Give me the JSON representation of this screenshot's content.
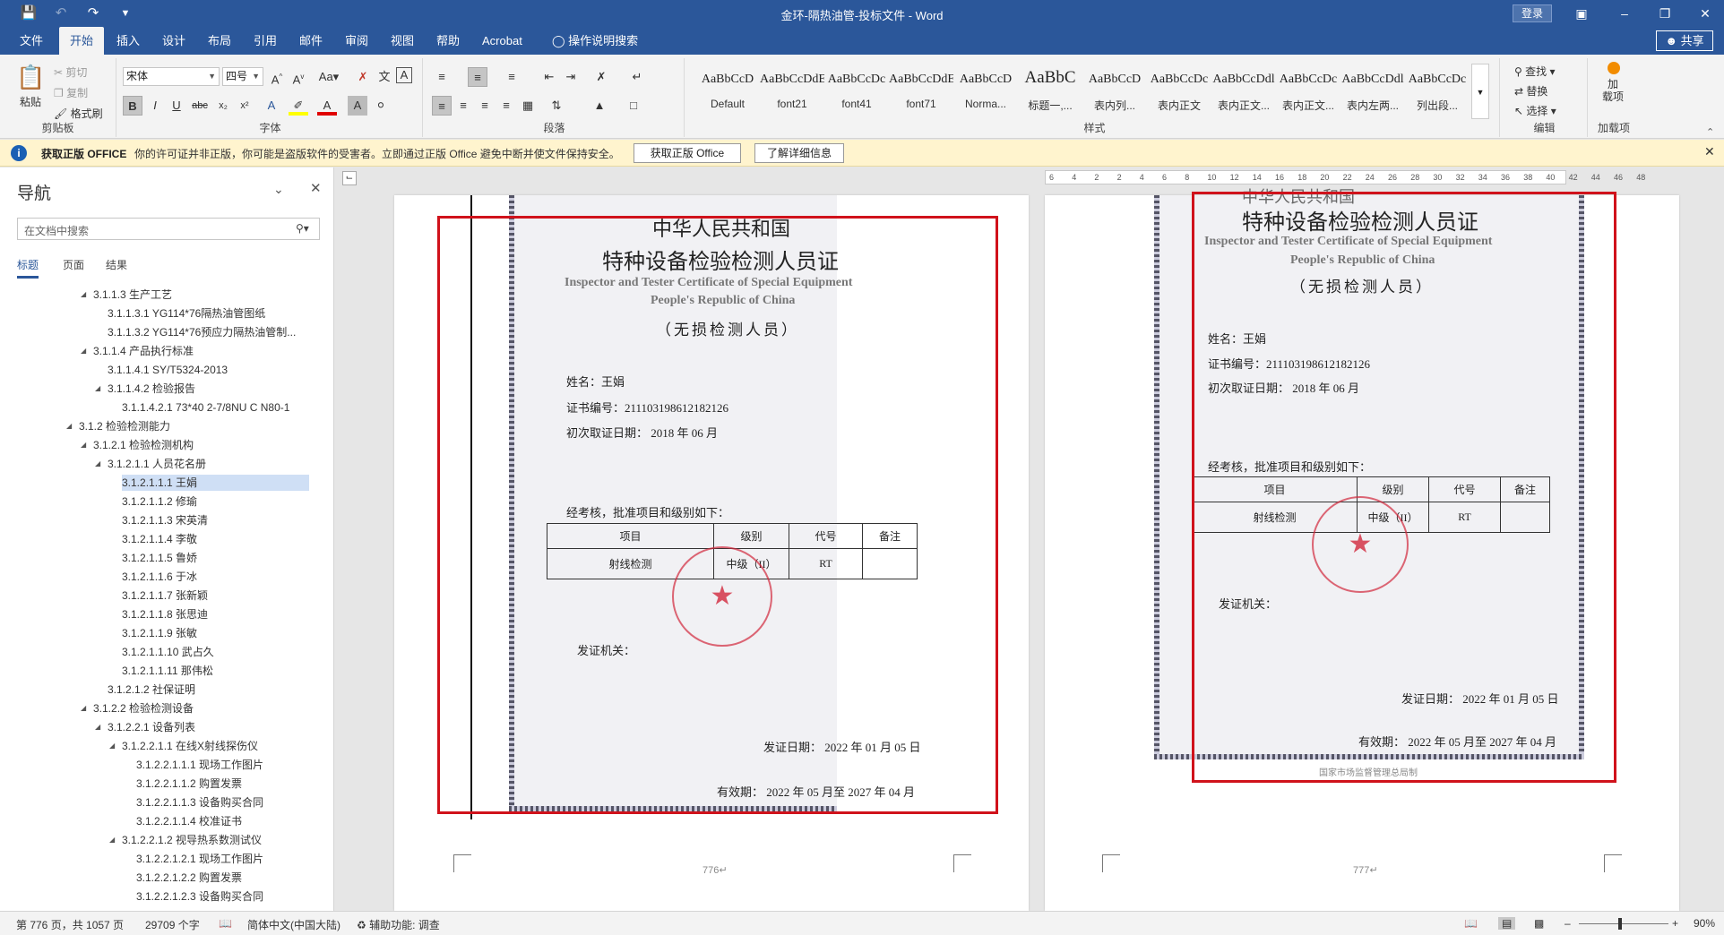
{
  "window": {
    "title": "金环-隔热油管-投标文件 - Word",
    "login": "登录",
    "quick_access": [
      "save-icon",
      "undo-icon",
      "redo-icon",
      "customize-icon"
    ]
  },
  "tabs": [
    "文件",
    "开始",
    "插入",
    "设计",
    "布局",
    "引用",
    "邮件",
    "审阅",
    "视图",
    "帮助",
    "Acrobat"
  ],
  "tell_me": "操作说明搜索",
  "share": "共享",
  "ribbon": {
    "clipboard": {
      "label": "剪贴板",
      "paste": "粘贴",
      "cut": "剪切",
      "copy": "复制",
      "format_painter": "格式刷"
    },
    "font": {
      "label": "字体",
      "font_name": "宋体",
      "font_size": "四号"
    },
    "paragraph": {
      "label": "段落"
    },
    "styles": {
      "label": "样式",
      "items": [
        {
          "preview": "AaBbCcD",
          "name": "Default"
        },
        {
          "preview": "AaBbCcDdE",
          "name": "font21"
        },
        {
          "preview": "AaBbCcDc",
          "name": "font41"
        },
        {
          "preview": "AaBbCcDdEe",
          "name": "font71"
        },
        {
          "preview": "AaBbCcD",
          "name": "Norma..."
        },
        {
          "preview": "AaBbC",
          "name": "标题一,..."
        },
        {
          "preview": "AaBbCcD",
          "name": "表内列..."
        },
        {
          "preview": "AaBbCcDc",
          "name": "表内正文"
        },
        {
          "preview": "AaBbCcDdl",
          "name": "表内正文..."
        },
        {
          "preview": "AaBbCcDc",
          "name": "表内正文..."
        },
        {
          "preview": "AaBbCcDdl",
          "name": "表内左两..."
        },
        {
          "preview": "AaBbCcDc",
          "name": "列出段..."
        }
      ]
    },
    "editing": {
      "label": "编辑",
      "find": "查找",
      "replace": "替换",
      "select": "选择"
    },
    "addins": {
      "label": "加载项",
      "button": "加\n载项"
    }
  },
  "notice": {
    "title": "获取正版 OFFICE",
    "text": "你的许可证并非正版，你可能是盗版软件的受害者。立即通过正版 Office 避免中断并使文件保持安全。",
    "button1": "获取正版 Office",
    "button2": "了解详细信息"
  },
  "nav": {
    "title": "导航",
    "search_placeholder": "在文档中搜索",
    "tabs": [
      "标题",
      "页面",
      "结果"
    ],
    "items": [
      {
        "text": "3.1.1.3 生产工艺",
        "level": 4,
        "expanded": true
      },
      {
        "text": "3.1.1.3.1 YG114*76隔热油管图纸",
        "level": 5
      },
      {
        "text": "3.1.1.3.2 YG114*76预应力隔热油管制...",
        "level": 5
      },
      {
        "text": "3.1.1.4 产品执行标准",
        "level": 4,
        "expanded": true
      },
      {
        "text": "3.1.1.4.1 SY/T5324-2013",
        "level": 5
      },
      {
        "text": "3.1.1.4.2 检验报告",
        "level": 5,
        "expanded": true
      },
      {
        "text": "3.1.1.4.2.1 73*40 2-7/8NU C N80-1",
        "level": 6
      },
      {
        "text": "3.1.2 检验检测能力",
        "level": 3,
        "expanded": true
      },
      {
        "text": "3.1.2.1 检验检测机构",
        "level": 4,
        "expanded": true
      },
      {
        "text": "3.1.2.1.1 人员花名册",
        "level": 5,
        "expanded": true
      },
      {
        "text": "3.1.2.1.1.1 王娟",
        "level": 6,
        "selected": true
      },
      {
        "text": "3.1.2.1.1.2 修瑜",
        "level": 6
      },
      {
        "text": "3.1.2.1.1.3 宋英清",
        "level": 6
      },
      {
        "text": "3.1.2.1.1.4 李敬",
        "level": 6
      },
      {
        "text": "3.1.2.1.1.5 鲁娇",
        "level": 6
      },
      {
        "text": "3.1.2.1.1.6 于冰",
        "level": 6
      },
      {
        "text": "3.1.2.1.1.7 张新颖",
        "level": 6
      },
      {
        "text": "3.1.2.1.1.8 张思迪",
        "level": 6
      },
      {
        "text": "3.1.2.1.1.9 张敏",
        "level": 6
      },
      {
        "text": "3.1.2.1.1.10 武占久",
        "level": 6
      },
      {
        "text": "3.1.2.1.1.11 那伟松",
        "level": 6
      },
      {
        "text": "3.1.2.1.2 社保证明",
        "level": 5
      },
      {
        "text": "3.1.2.2 检验检测设备",
        "level": 4,
        "expanded": true
      },
      {
        "text": "3.1.2.2.1 设备列表",
        "level": 5,
        "expanded": true
      },
      {
        "text": "3.1.2.2.1.1 在线X射线探伤仪",
        "level": 6,
        "expanded": true
      },
      {
        "text": "3.1.2.2.1.1.1 现场工作图片",
        "level": 7
      },
      {
        "text": "3.1.2.2.1.1.2 购置发票",
        "level": 7
      },
      {
        "text": "3.1.2.2.1.1.3 设备购买合同",
        "level": 7
      },
      {
        "text": "3.1.2.2.1.1.4 校准证书",
        "level": 7
      },
      {
        "text": "3.1.2.2.1.2 视导热系数测试仪",
        "level": 6,
        "expanded": true
      },
      {
        "text": "3.1.2.2.1.2.1 现场工作图片",
        "level": 7
      },
      {
        "text": "3.1.2.2.1.2.2 购置发票",
        "level": 7
      },
      {
        "text": "3.1.2.2.1.2.3 设备购买合同",
        "level": 7
      }
    ]
  },
  "ruler": [
    "6",
    "4",
    "2",
    "2",
    "4",
    "6",
    "8",
    "10",
    "12",
    "14",
    "16",
    "18",
    "20",
    "22",
    "24",
    "26",
    "28",
    "30",
    "32",
    "34",
    "36",
    "38",
    "40",
    "42",
    "44",
    "46",
    "48"
  ],
  "pages": [
    {
      "header_top": "中华人民共和国",
      "title": "特种设备检验检测人员证",
      "en1": "Inspector and Tester Certificate of Special Equipment",
      "en2": "People's Republic of China",
      "subtitle": "（无损检测人员）",
      "name": "姓名：王娟",
      "cert_no": "证书编号：211103198612182126",
      "first_date": "初次取证日期：  2018 年 06 月",
      "approved": "经考核，批准项目和级别如下：",
      "table_head": [
        "项目",
        "级别",
        "代号",
        "备注"
      ],
      "table_row": [
        "射线检测",
        "中级（II）",
        "RT",
        ""
      ],
      "authority": "发证机关：",
      "issue_date": "发证日期：  2022 年 01 月 05 日",
      "valid": "有效期：  2022 年 05 月至 2027 年 04 月",
      "page_number": "776↵"
    },
    {
      "header_top": "中华人民共和国",
      "title": "特种设备检验检测人员证",
      "en1": "Inspector and Tester Certificate of Special Equipment",
      "en2": "People's Republic of China",
      "subtitle": "（无损检测人员）",
      "name": "姓名：王娟",
      "cert_no": "证书编号：211103198612182126",
      "first_date": "初次取证日期：  2018 年 06 月",
      "approved": "经考核，批准项目和级别如下：",
      "table_head": [
        "项目",
        "级别",
        "代号",
        "备注"
      ],
      "table_row": [
        "射线检测",
        "中级（II）",
        "RT",
        ""
      ],
      "authority": "发证机关：",
      "issue_date": "发证日期：  2022 年 01 月 05 日",
      "valid": "有效期：  2022 年 05 月至 2027 年 04 月",
      "footer": "国家市场监督管理总局制",
      "page_number": "777↵"
    }
  ],
  "status": {
    "page": "第 776 页，共 1057 页",
    "words": "29709 个字",
    "language": "简体中文(中国大陆)",
    "accessibility": "辅助功能: 调查",
    "zoom": "90%"
  }
}
